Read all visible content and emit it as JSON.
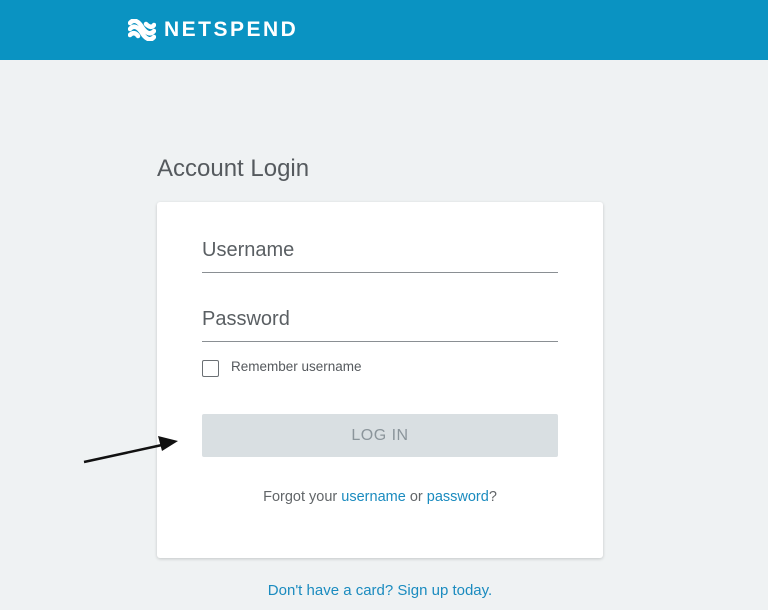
{
  "header": {
    "brand": "NETSPEND",
    "brand_color": "#0a93c2"
  },
  "page": {
    "title": "Account Login"
  },
  "form": {
    "username_placeholder": "Username",
    "password_placeholder": "Password",
    "remember_label": "Remember username",
    "remember_checked": false,
    "login_label": "LOG IN",
    "forgot_prefix": "Forgot your",
    "forgot_username": "username",
    "forgot_or": "or",
    "forgot_password": "password",
    "forgot_suffix": "?"
  },
  "footer": {
    "signup_link": "Don't have a card? Sign up today."
  },
  "colors": {
    "background": "#eff2f3",
    "link": "#1a8bbf",
    "button_disabled": "#d9dfe2"
  },
  "annotation": {
    "icon": "arrow-right-icon"
  }
}
